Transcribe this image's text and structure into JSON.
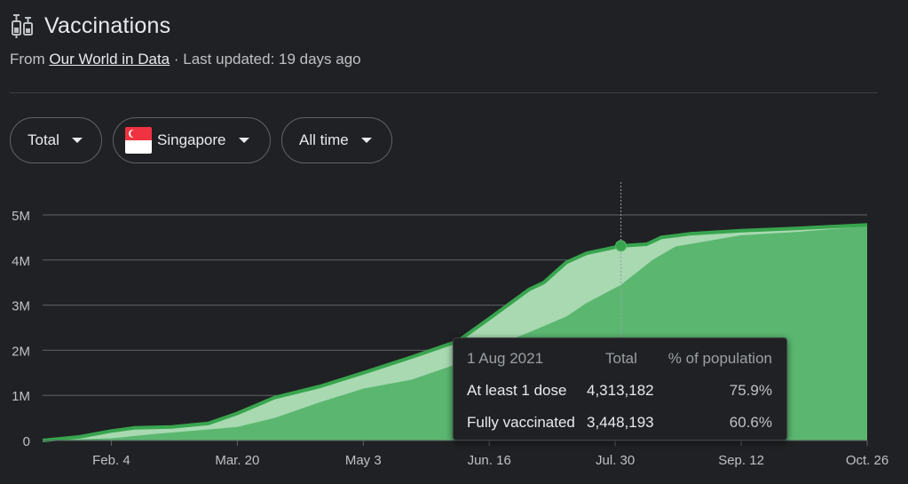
{
  "header": {
    "title": "Vaccinations",
    "source_prefix": "From",
    "source_link": "Our World in Data",
    "source_suffix": "· Last updated: 19 days ago"
  },
  "filters": {
    "metric": "Total",
    "country": "Singapore",
    "range": "All time"
  },
  "icons": {
    "title": "syringe-icon",
    "dropdown": "chevron-down-icon",
    "flag": "singapore-flag-icon"
  },
  "colors": {
    "background": "#202124",
    "dark_green": "#5bb770",
    "light_green": "#a8d9b1",
    "line_green": "#38a54e",
    "gridline": "#5f6368",
    "axis_text": "#bdc1c6"
  },
  "tooltip": {
    "date": "1 Aug 2021",
    "col_total": "Total",
    "col_pct": "% of population",
    "rows": [
      {
        "label": "At least 1 dose",
        "total": "4,313,182",
        "pct": "75.9%"
      },
      {
        "label": "Fully vaccinated",
        "total": "3,448,193",
        "pct": "60.6%"
      }
    ]
  },
  "chart_data": {
    "type": "area",
    "title": "",
    "xlabel": "",
    "ylabel": "",
    "x_range": [
      "2021-01-11",
      "2021-10-26"
    ],
    "ylim": [
      0,
      5000000
    ],
    "y_ticks": [
      0,
      1000000,
      2000000,
      3000000,
      4000000,
      5000000
    ],
    "y_tick_labels": [
      "0",
      "1M",
      "2M",
      "3M",
      "4M",
      "5M"
    ],
    "x_ticks": [
      "2021-02-04",
      "2021-03-20",
      "2021-05-03",
      "2021-06-16",
      "2021-07-30",
      "2021-09-12",
      "2021-10-26"
    ],
    "x_tick_labels": [
      "Feb. 4",
      "Mar. 20",
      "May 3",
      "Jun. 16",
      "Jul. 30",
      "Sep. 12",
      "Oct. 26"
    ],
    "hover_date": "2021-08-01",
    "grid": true,
    "series": [
      {
        "name": "At least 1 dose",
        "points": [
          [
            "2021-01-11",
            0
          ],
          [
            "2021-01-24",
            80000
          ],
          [
            "2021-02-04",
            210000
          ],
          [
            "2021-02-12",
            280000
          ],
          [
            "2021-02-25",
            300000
          ],
          [
            "2021-03-10",
            380000
          ],
          [
            "2021-03-20",
            600000
          ],
          [
            "2021-04-02",
            950000
          ],
          [
            "2021-04-18",
            1200000
          ],
          [
            "2021-05-03",
            1500000
          ],
          [
            "2021-05-20",
            1850000
          ],
          [
            "2021-06-05",
            2200000
          ],
          [
            "2021-06-16",
            2700000
          ],
          [
            "2021-06-30",
            3350000
          ],
          [
            "2021-07-05",
            3500000
          ],
          [
            "2021-07-13",
            3950000
          ],
          [
            "2021-07-20",
            4150000
          ],
          [
            "2021-08-01",
            4313182
          ],
          [
            "2021-08-10",
            4350000
          ],
          [
            "2021-08-15",
            4500000
          ],
          [
            "2021-08-25",
            4580000
          ],
          [
            "2021-09-12",
            4650000
          ],
          [
            "2021-10-01",
            4700000
          ],
          [
            "2021-10-26",
            4780000
          ]
        ]
      },
      {
        "name": "Fully vaccinated",
        "points": [
          [
            "2021-01-11",
            0
          ],
          [
            "2021-02-04",
            50000
          ],
          [
            "2021-02-20",
            150000
          ],
          [
            "2021-03-20",
            300000
          ],
          [
            "2021-04-02",
            500000
          ],
          [
            "2021-04-18",
            850000
          ],
          [
            "2021-05-03",
            1150000
          ],
          [
            "2021-05-20",
            1350000
          ],
          [
            "2021-06-05",
            1700000
          ],
          [
            "2021-06-16",
            2050000
          ],
          [
            "2021-06-30",
            2400000
          ],
          [
            "2021-07-13",
            2750000
          ],
          [
            "2021-07-20",
            3050000
          ],
          [
            "2021-08-01",
            3448193
          ],
          [
            "2021-08-12",
            4000000
          ],
          [
            "2021-08-20",
            4300000
          ],
          [
            "2021-09-12",
            4550000
          ],
          [
            "2021-10-01",
            4620000
          ],
          [
            "2021-10-26",
            4750000
          ]
        ]
      }
    ]
  }
}
